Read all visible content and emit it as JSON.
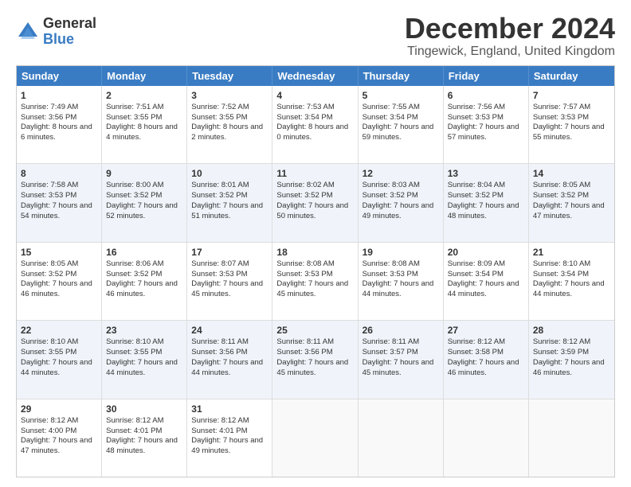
{
  "logo": {
    "text_general": "General",
    "text_blue": "Blue"
  },
  "title": "December 2024",
  "subtitle": "Tingewick, England, United Kingdom",
  "days_of_week": [
    "Sunday",
    "Monday",
    "Tuesday",
    "Wednesday",
    "Thursday",
    "Friday",
    "Saturday"
  ],
  "weeks": [
    [
      {
        "day": "1",
        "sunrise": "7:49 AM",
        "sunset": "3:56 PM",
        "daylight": "8 hours and 6 minutes."
      },
      {
        "day": "2",
        "sunrise": "7:51 AM",
        "sunset": "3:55 PM",
        "daylight": "8 hours and 4 minutes."
      },
      {
        "day": "3",
        "sunrise": "7:52 AM",
        "sunset": "3:55 PM",
        "daylight": "8 hours and 2 minutes."
      },
      {
        "day": "4",
        "sunrise": "7:53 AM",
        "sunset": "3:54 PM",
        "daylight": "8 hours and 0 minutes."
      },
      {
        "day": "5",
        "sunrise": "7:55 AM",
        "sunset": "3:54 PM",
        "daylight": "7 hours and 59 minutes."
      },
      {
        "day": "6",
        "sunrise": "7:56 AM",
        "sunset": "3:53 PM",
        "daylight": "7 hours and 57 minutes."
      },
      {
        "day": "7",
        "sunrise": "7:57 AM",
        "sunset": "3:53 PM",
        "daylight": "7 hours and 55 minutes."
      }
    ],
    [
      {
        "day": "8",
        "sunrise": "7:58 AM",
        "sunset": "3:53 PM",
        "daylight": "7 hours and 54 minutes."
      },
      {
        "day": "9",
        "sunrise": "8:00 AM",
        "sunset": "3:52 PM",
        "daylight": "7 hours and 52 minutes."
      },
      {
        "day": "10",
        "sunrise": "8:01 AM",
        "sunset": "3:52 PM",
        "daylight": "7 hours and 51 minutes."
      },
      {
        "day": "11",
        "sunrise": "8:02 AM",
        "sunset": "3:52 PM",
        "daylight": "7 hours and 50 minutes."
      },
      {
        "day": "12",
        "sunrise": "8:03 AM",
        "sunset": "3:52 PM",
        "daylight": "7 hours and 49 minutes."
      },
      {
        "day": "13",
        "sunrise": "8:04 AM",
        "sunset": "3:52 PM",
        "daylight": "7 hours and 48 minutes."
      },
      {
        "day": "14",
        "sunrise": "8:05 AM",
        "sunset": "3:52 PM",
        "daylight": "7 hours and 47 minutes."
      }
    ],
    [
      {
        "day": "15",
        "sunrise": "8:05 AM",
        "sunset": "3:52 PM",
        "daylight": "7 hours and 46 minutes."
      },
      {
        "day": "16",
        "sunrise": "8:06 AM",
        "sunset": "3:52 PM",
        "daylight": "7 hours and 46 minutes."
      },
      {
        "day": "17",
        "sunrise": "8:07 AM",
        "sunset": "3:53 PM",
        "daylight": "7 hours and 45 minutes."
      },
      {
        "day": "18",
        "sunrise": "8:08 AM",
        "sunset": "3:53 PM",
        "daylight": "7 hours and 45 minutes."
      },
      {
        "day": "19",
        "sunrise": "8:08 AM",
        "sunset": "3:53 PM",
        "daylight": "7 hours and 44 minutes."
      },
      {
        "day": "20",
        "sunrise": "8:09 AM",
        "sunset": "3:54 PM",
        "daylight": "7 hours and 44 minutes."
      },
      {
        "day": "21",
        "sunrise": "8:10 AM",
        "sunset": "3:54 PM",
        "daylight": "7 hours and 44 minutes."
      }
    ],
    [
      {
        "day": "22",
        "sunrise": "8:10 AM",
        "sunset": "3:55 PM",
        "daylight": "7 hours and 44 minutes."
      },
      {
        "day": "23",
        "sunrise": "8:10 AM",
        "sunset": "3:55 PM",
        "daylight": "7 hours and 44 minutes."
      },
      {
        "day": "24",
        "sunrise": "8:11 AM",
        "sunset": "3:56 PM",
        "daylight": "7 hours and 44 minutes."
      },
      {
        "day": "25",
        "sunrise": "8:11 AM",
        "sunset": "3:56 PM",
        "daylight": "7 hours and 45 minutes."
      },
      {
        "day": "26",
        "sunrise": "8:11 AM",
        "sunset": "3:57 PM",
        "daylight": "7 hours and 45 minutes."
      },
      {
        "day": "27",
        "sunrise": "8:12 AM",
        "sunset": "3:58 PM",
        "daylight": "7 hours and 46 minutes."
      },
      {
        "day": "28",
        "sunrise": "8:12 AM",
        "sunset": "3:59 PM",
        "daylight": "7 hours and 46 minutes."
      }
    ],
    [
      {
        "day": "29",
        "sunrise": "8:12 AM",
        "sunset": "4:00 PM",
        "daylight": "7 hours and 47 minutes."
      },
      {
        "day": "30",
        "sunrise": "8:12 AM",
        "sunset": "4:01 PM",
        "daylight": "7 hours and 48 minutes."
      },
      {
        "day": "31",
        "sunrise": "8:12 AM",
        "sunset": "4:01 PM",
        "daylight": "7 hours and 49 minutes."
      },
      null,
      null,
      null,
      null
    ]
  ]
}
